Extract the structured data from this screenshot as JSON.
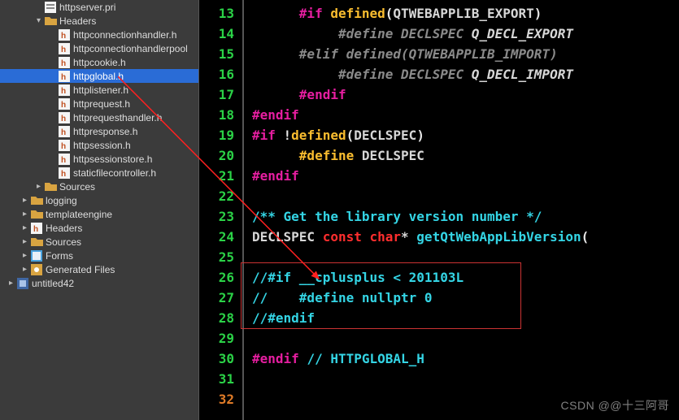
{
  "watermark": "CSDN @@十三阿哥",
  "tree": [
    {
      "depth": 1,
      "toggle": "",
      "icon": "pri",
      "label": "httpserver.pri"
    },
    {
      "depth": 1,
      "toggle": "▾",
      "icon": "folder",
      "label": "Headers"
    },
    {
      "depth": 2,
      "toggle": "",
      "icon": "h",
      "label": "httpconnectionhandler.h"
    },
    {
      "depth": 2,
      "toggle": "",
      "icon": "h",
      "label": "httpconnectionhandlerpool"
    },
    {
      "depth": 2,
      "toggle": "",
      "icon": "h",
      "label": "httpcookie.h"
    },
    {
      "depth": 2,
      "toggle": "",
      "icon": "h",
      "label": "httpglobal.h",
      "selected": true
    },
    {
      "depth": 2,
      "toggle": "",
      "icon": "h",
      "label": "httplistener.h"
    },
    {
      "depth": 2,
      "toggle": "",
      "icon": "h",
      "label": "httprequest.h"
    },
    {
      "depth": 2,
      "toggle": "",
      "icon": "h",
      "label": "httprequesthandler.h"
    },
    {
      "depth": 2,
      "toggle": "",
      "icon": "h",
      "label": "httpresponse.h"
    },
    {
      "depth": 2,
      "toggle": "",
      "icon": "h",
      "label": "httpsession.h"
    },
    {
      "depth": 2,
      "toggle": "",
      "icon": "h",
      "label": "httpsessionstore.h"
    },
    {
      "depth": 2,
      "toggle": "",
      "icon": "h",
      "label": "staticfilecontroller.h"
    },
    {
      "depth": 1,
      "toggle": "▸",
      "icon": "folder",
      "label": "Sources"
    },
    {
      "depth": 0,
      "toggle": "▸",
      "icon": "folder",
      "label": "logging"
    },
    {
      "depth": 0,
      "toggle": "▸",
      "icon": "folder",
      "label": "templateengine"
    },
    {
      "depth": 0,
      "toggle": "▸",
      "icon": "h",
      "label": "Headers"
    },
    {
      "depth": 0,
      "toggle": "▸",
      "icon": "folder",
      "label": "Sources"
    },
    {
      "depth": 0,
      "toggle": "▸",
      "icon": "form",
      "label": "Forms"
    },
    {
      "depth": 0,
      "toggle": "▸",
      "icon": "gen",
      "label": "Generated Files"
    },
    {
      "depth": -1,
      "toggle": "▸",
      "icon": "proj",
      "label": "untitled42"
    }
  ],
  "line_numbers": [
    "13",
    "14",
    "15",
    "16",
    "17",
    "18",
    "19",
    "20",
    "21",
    "22",
    "23",
    "24",
    "25",
    "26",
    "27",
    "28",
    "29",
    "30",
    "31",
    "32"
  ],
  "current_line_index": 19,
  "code_tokens": {
    "l13": {
      "indent": "      ",
      "t1": "#if ",
      "t2": "defined",
      "t3": "(",
      "t4": "QTWEBAPPLIB_EXPORT",
      "t5": ")"
    },
    "l14": {
      "indent": "           ",
      "t1": "#define ",
      "t2": "DECLSPEC ",
      "t3": "Q_DECL_EXPORT"
    },
    "l15": {
      "indent": "      ",
      "t1": "#elif ",
      "t2": "defined",
      "t3": "(",
      "t4": "QTWEBAPPLIB_IMPORT",
      "t5": ")"
    },
    "l16": {
      "indent": "           ",
      "t1": "#define ",
      "t2": "DECLSPEC ",
      "t3": "Q_DECL_IMPORT"
    },
    "l17": {
      "indent": "      ",
      "t1": "#endif"
    },
    "l18": {
      "indent": "",
      "t1": "#endif"
    },
    "l19": {
      "indent": "",
      "t1": "#if ",
      "t2": "!",
      "t3": "defined",
      "t4": "(",
      "t5": "DECLSPEC",
      "t6": ")"
    },
    "l20": {
      "indent": "      ",
      "t1": "#define ",
      "t2": "DECLSPEC"
    },
    "l21": {
      "indent": "",
      "t1": "#endif"
    },
    "l22": {
      "indent": ""
    },
    "l23": {
      "indent": "",
      "t1": "/** Get the library version number */"
    },
    "l24": {
      "indent": "",
      "t1": "DECLSPEC ",
      "t2": "const ",
      "t3": "char",
      "t4": "* ",
      "t5": "getQtWebAppLibVersion",
      "t6": "("
    },
    "l25": {
      "indent": ""
    },
    "l26": {
      "indent": "",
      "t1": "//#if __cplusplus < 201103L"
    },
    "l27": {
      "indent": "",
      "t1": "//    #define nullptr 0"
    },
    "l28": {
      "indent": "",
      "t1": "//#endif"
    },
    "l29": {
      "indent": ""
    },
    "l30": {
      "indent": "",
      "t1": "#endif ",
      "t2": "// HTTPGLOBAL_H"
    },
    "l31": {
      "indent": ""
    },
    "l32": {
      "indent": ""
    }
  }
}
